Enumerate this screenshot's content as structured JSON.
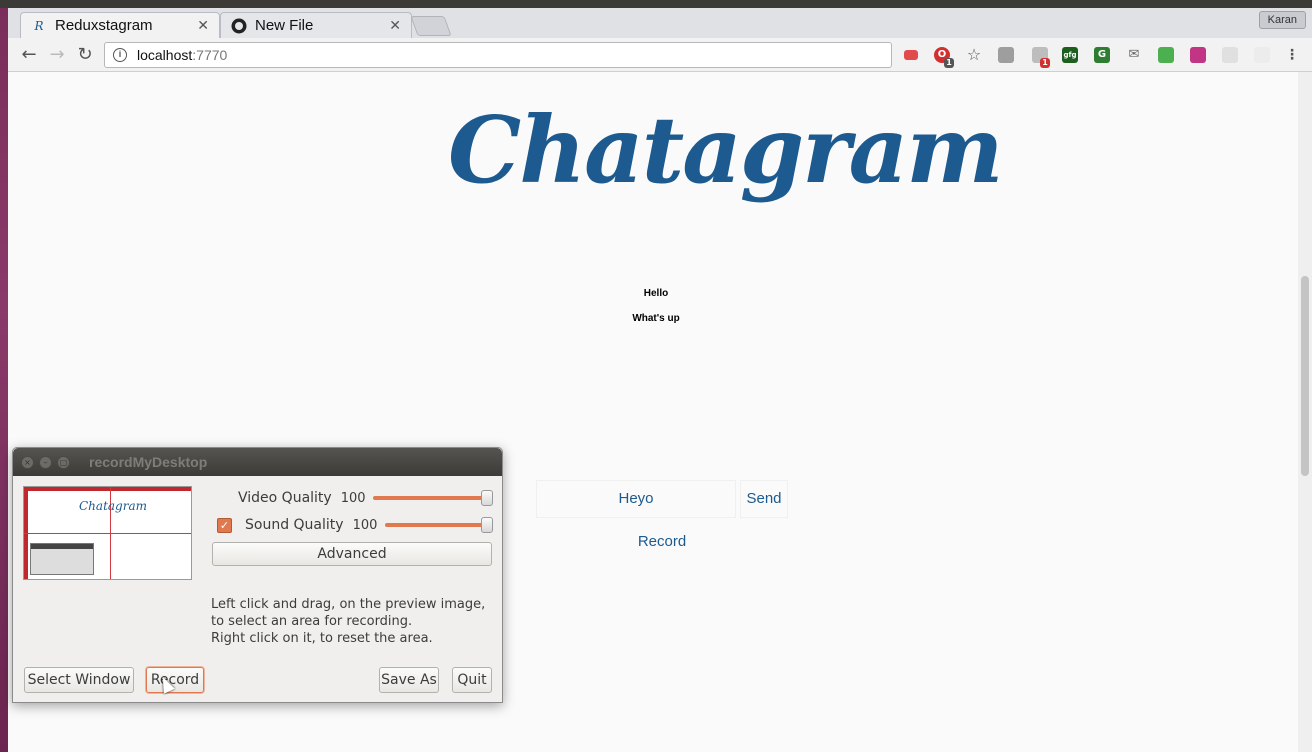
{
  "browser": {
    "tabs": [
      {
        "label": "Reduxstagram",
        "favicon": "R"
      },
      {
        "label": "New File",
        "favicon": "github-icon"
      }
    ],
    "user": "Karan",
    "address": {
      "host": "localhost",
      "port": ":7770"
    },
    "extension_badges": [
      "1",
      "1"
    ],
    "extension_labels": [
      "gfg"
    ]
  },
  "page": {
    "logo": "Chatagram",
    "messages": [
      "Hello",
      "What's up"
    ],
    "input_value": "Heyo",
    "send_label": "Send",
    "record_label": "Record"
  },
  "recorder": {
    "title": "recordMyDesktop",
    "video_quality_label": "Video Quality",
    "video_quality_value": "100",
    "sound_quality_label": "Sound Quality",
    "sound_quality_value": "100",
    "advanced_label": "Advanced",
    "help_line1": "Left click and drag, on the preview image,",
    "help_line2": "to select an area for recording.",
    "help_line3": "Right click on it, to reset the area.",
    "preview_logo": "Chatagram",
    "buttons": {
      "select_window": "Select Window",
      "record": "Record",
      "save_as": "Save As",
      "quit": "Quit"
    }
  },
  "colors": {
    "brand": "#1c5a8f",
    "accent": "#e07a4e"
  }
}
